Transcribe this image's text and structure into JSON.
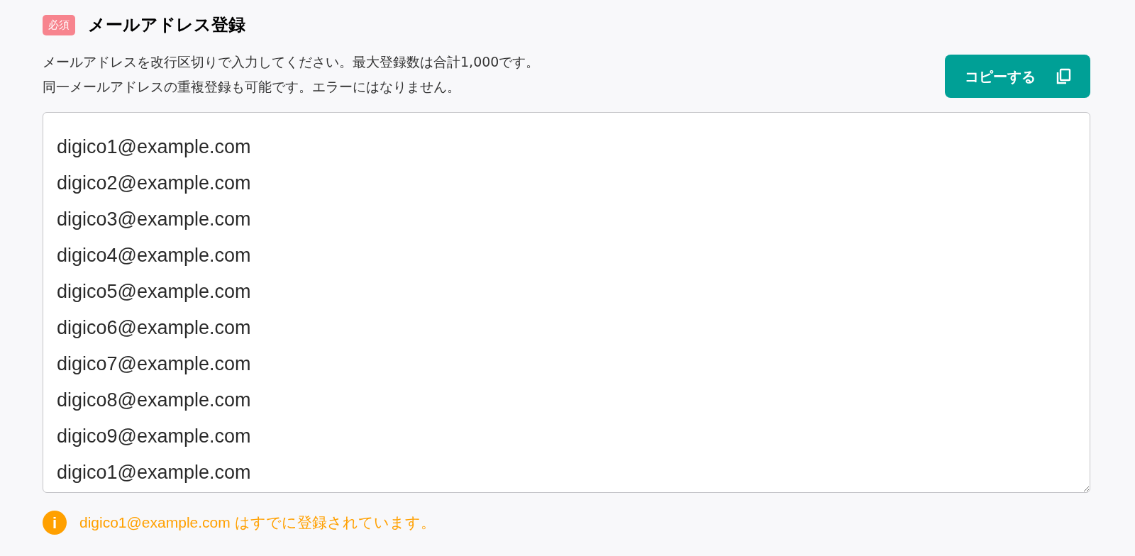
{
  "section": {
    "badge": "必須",
    "title": "メールアドレス登録"
  },
  "description": [
    "メールアドレスを改行区切りで入力してください。最大登録数は合計1,000です。",
    "同一メールアドレスの重複登録も可能です。エラーにはなりません。"
  ],
  "copy_button": {
    "label": "コピーする"
  },
  "email_input": {
    "lines": [
      "digico1@example.com",
      "digico2@example.com",
      "digico3@example.com",
      "digico4@example.com",
      "digico5@example.com",
      "digico6@example.com",
      "digico7@example.com",
      "digico8@example.com",
      "digico9@example.com",
      "digico1@example.com"
    ]
  },
  "message": {
    "kind": "warning",
    "icon": "i",
    "text": "digico1@example.com はすでに登録されています。"
  }
}
